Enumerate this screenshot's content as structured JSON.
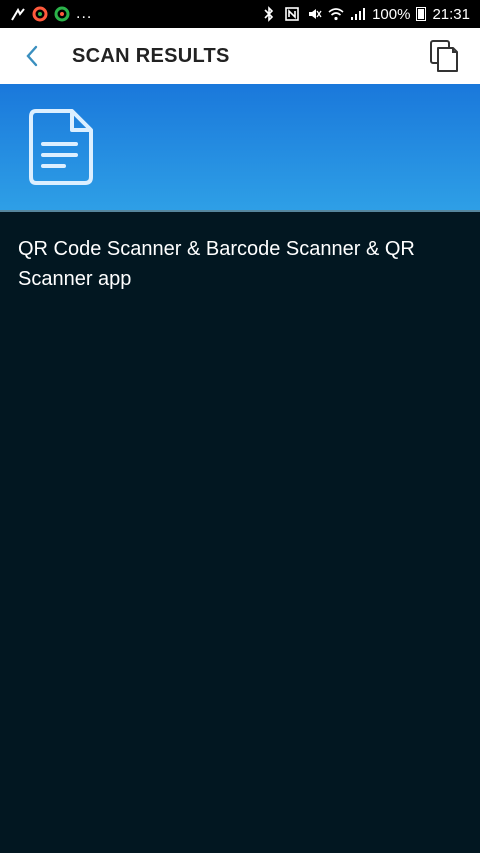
{
  "status_bar": {
    "dots": "...",
    "battery_pct": "100%",
    "time": "21:31"
  },
  "appbar": {
    "title": "SCAN RESULTS"
  },
  "result": {
    "text": "QR Code Scanner & Barcode Scanner & QR Scanner app"
  },
  "colors": {
    "banner_top": "#1a78db",
    "banner_bottom": "#2e9fe6",
    "background": "#021721",
    "accent": "#3a8fbf"
  },
  "icons": [
    "back-arrow-icon",
    "copy-icon",
    "document-icon"
  ]
}
